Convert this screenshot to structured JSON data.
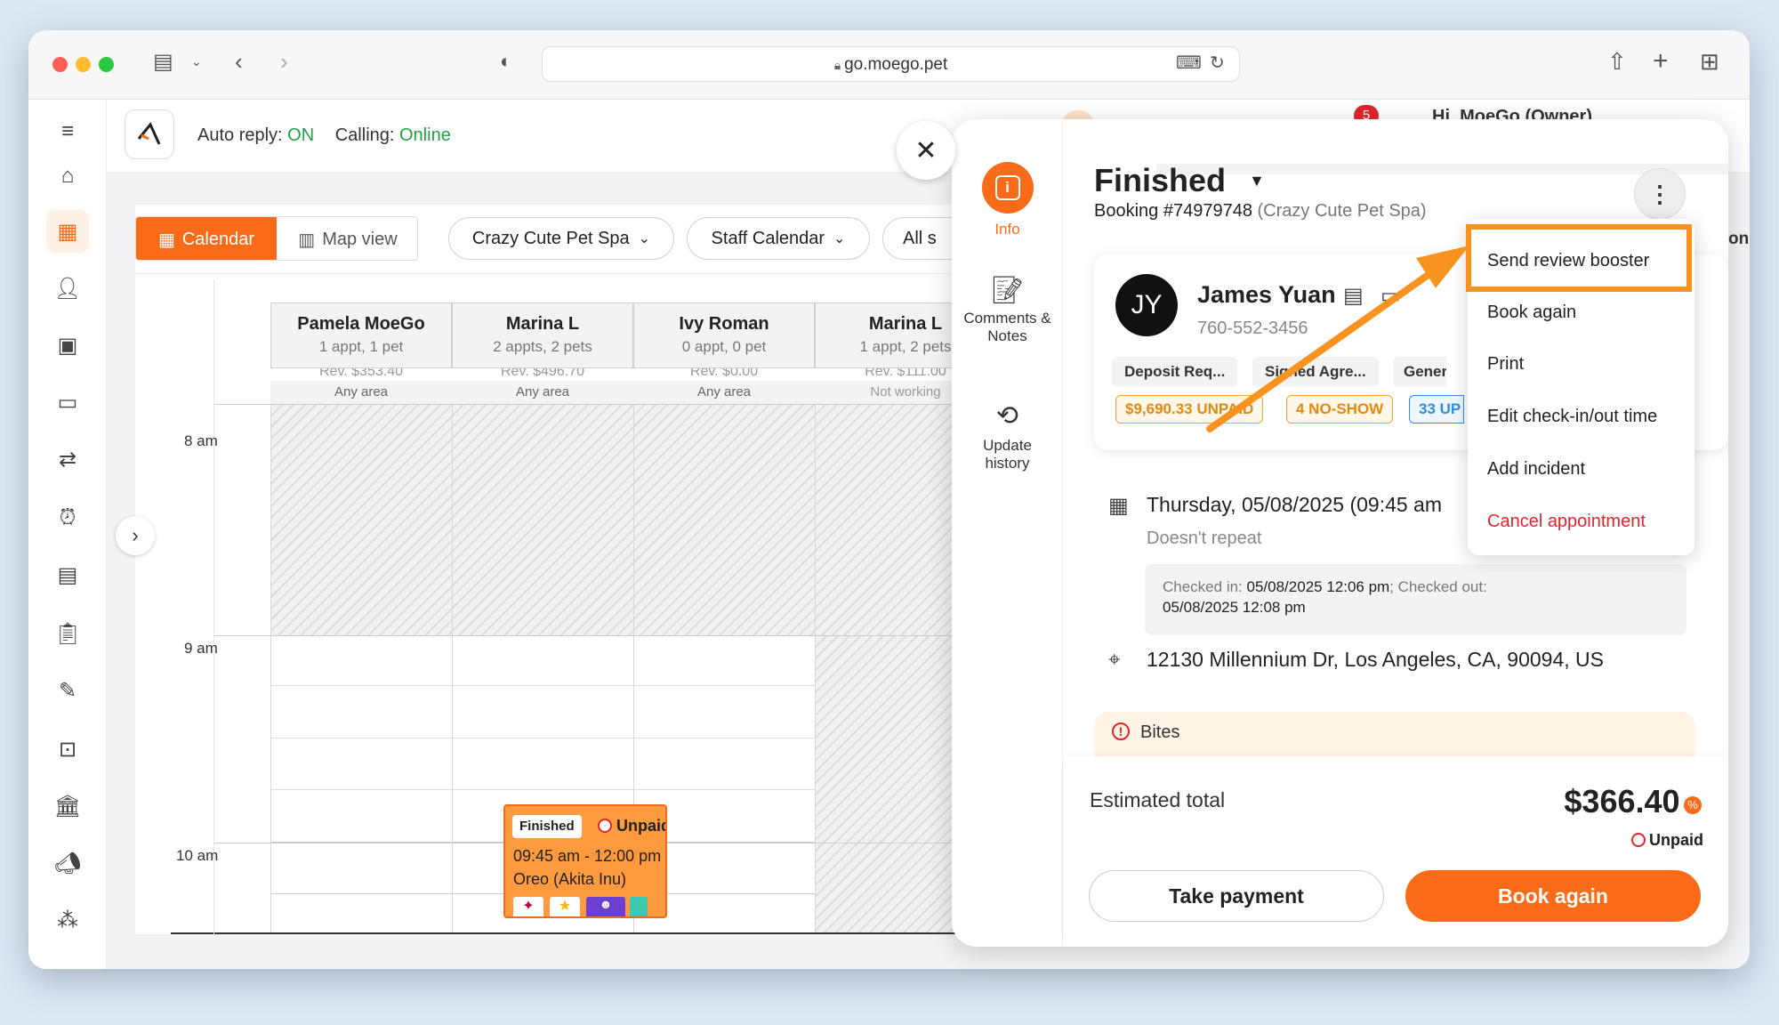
{
  "browser": {
    "url": "go.moego.pet"
  },
  "topbar": {
    "auto_reply_label": "Auto reply:",
    "auto_reply_value": "ON",
    "calling_label": "Calling:",
    "calling_value": "Online",
    "notification_count": "5",
    "user_fragment": "Hi, MoeGo (Owner)"
  },
  "sidebar": {
    "items": [
      "menu",
      "home",
      "calendar",
      "clients",
      "pets",
      "messages",
      "leads",
      "reminders",
      "services",
      "reports",
      "marketing",
      "booking",
      "finance",
      "campaigns",
      "rewards"
    ]
  },
  "calendar": {
    "view_tabs": [
      "Calendar",
      "Map view"
    ],
    "active_tab": "Calendar",
    "filters": [
      "Crazy Cute Pet Spa",
      "Staff Calendar",
      "All s"
    ],
    "columns": [
      {
        "name": "Pamela MoeGo",
        "summary": "1 appt, 1 pet",
        "revenue": "Rev. $353.40",
        "area": "Any area"
      },
      {
        "name": "Marina L",
        "summary": "2 appts, 2 pets",
        "revenue": "Rev. $496.70",
        "area": "Any area"
      },
      {
        "name": "Ivy Roman",
        "summary": "0 appt, 0 pet",
        "revenue": "Rev. $0.00",
        "area": "Any area"
      },
      {
        "name": "Marina L",
        "summary": "1 appt, 2 pets",
        "revenue": "Rev. $111.00",
        "area": "Not working"
      }
    ],
    "times": [
      "8 am",
      "9 am",
      "10 am"
    ],
    "appointment": {
      "status": "Finished",
      "payment": "Unpaid",
      "time": "09:45 am - 12:00 pm",
      "pet": "Oreo  (Akita Inu)"
    }
  },
  "panel": {
    "nav": [
      {
        "label": "Info"
      },
      {
        "label": "Comments &\nNotes"
      },
      {
        "label": "Update\nhistory"
      }
    ],
    "status": "Finished",
    "booking_no": "Booking #74979748",
    "business": "(Crazy Cute Pet Spa)",
    "client": {
      "initials": "JY",
      "name": "James Yuan",
      "phone": "760-552-3456",
      "tags": [
        "Deposit Req...",
        "Signed Agre...",
        "Generou"
      ],
      "badges": [
        "$9,690.33 UNPAID",
        "4 NO-SHOW",
        "33 UP"
      ],
      "right_fragment": "on"
    },
    "date": "Thursday, 05/08/2025  (09:45 am",
    "repeat": "Doesn't repeat",
    "checked_in_label": "Checked in:",
    "checked_in_value": "05/08/2025 12:06 pm",
    "checked_out_label": "; Checked out:",
    "checked_out_value": "05/08/2025 12:08 pm",
    "address": "12130 Millennium Dr, Los Angeles, CA, 90094, US",
    "alert": "Bites",
    "estimated_total_label": "Estimated total",
    "total": "$366.40",
    "payment_status": "Unpaid",
    "take_payment": "Take payment",
    "book_again": "Book again"
  },
  "menu": {
    "items": [
      "Send review booster",
      "Book again",
      "Print",
      "Edit check-in/out time",
      "Add incident",
      "Cancel appointment"
    ],
    "highlighted": "Send review booster",
    "danger_item": "Cancel appointment"
  },
  "colors": {
    "accent": "#f96b18",
    "online": "#22a048",
    "danger": "#e0262d",
    "highlight_box": "#f7931e"
  }
}
